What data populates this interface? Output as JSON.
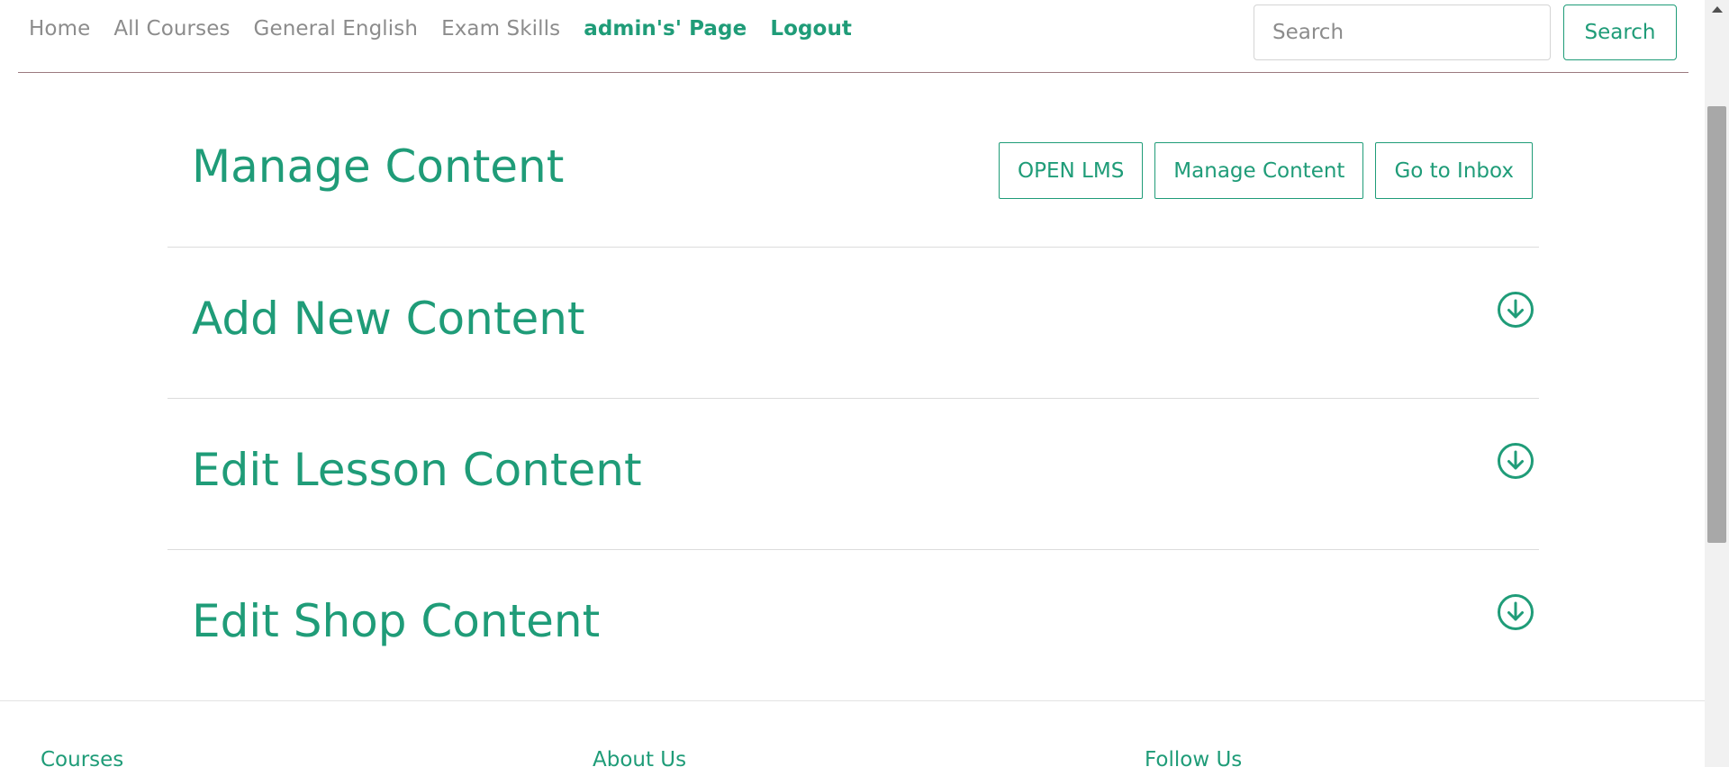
{
  "nav": {
    "links": [
      "Home",
      "All Courses",
      "General English",
      "Exam Skills"
    ],
    "admin_link": "admin's' Page",
    "logout_link": "Logout",
    "search_placeholder": "Search",
    "search_button": "Search"
  },
  "main": {
    "title": "Manage Content",
    "buttons": [
      "OPEN LMS",
      "Manage Content",
      "Go to Inbox"
    ],
    "sections": [
      {
        "title": "Add New Content",
        "icon": "arrow-down-circle-icon"
      },
      {
        "title": "Edit Lesson Content",
        "icon": "arrow-down-circle-icon"
      },
      {
        "title": "Edit Shop Content",
        "icon": "arrow-down-circle-icon"
      }
    ]
  },
  "footer": {
    "columns": [
      "Courses",
      "About Us",
      "Follow Us"
    ]
  },
  "colors": {
    "accent": "#1f9c78",
    "nav_text": "#8c8c8c",
    "divider": "#dcdcdc"
  }
}
